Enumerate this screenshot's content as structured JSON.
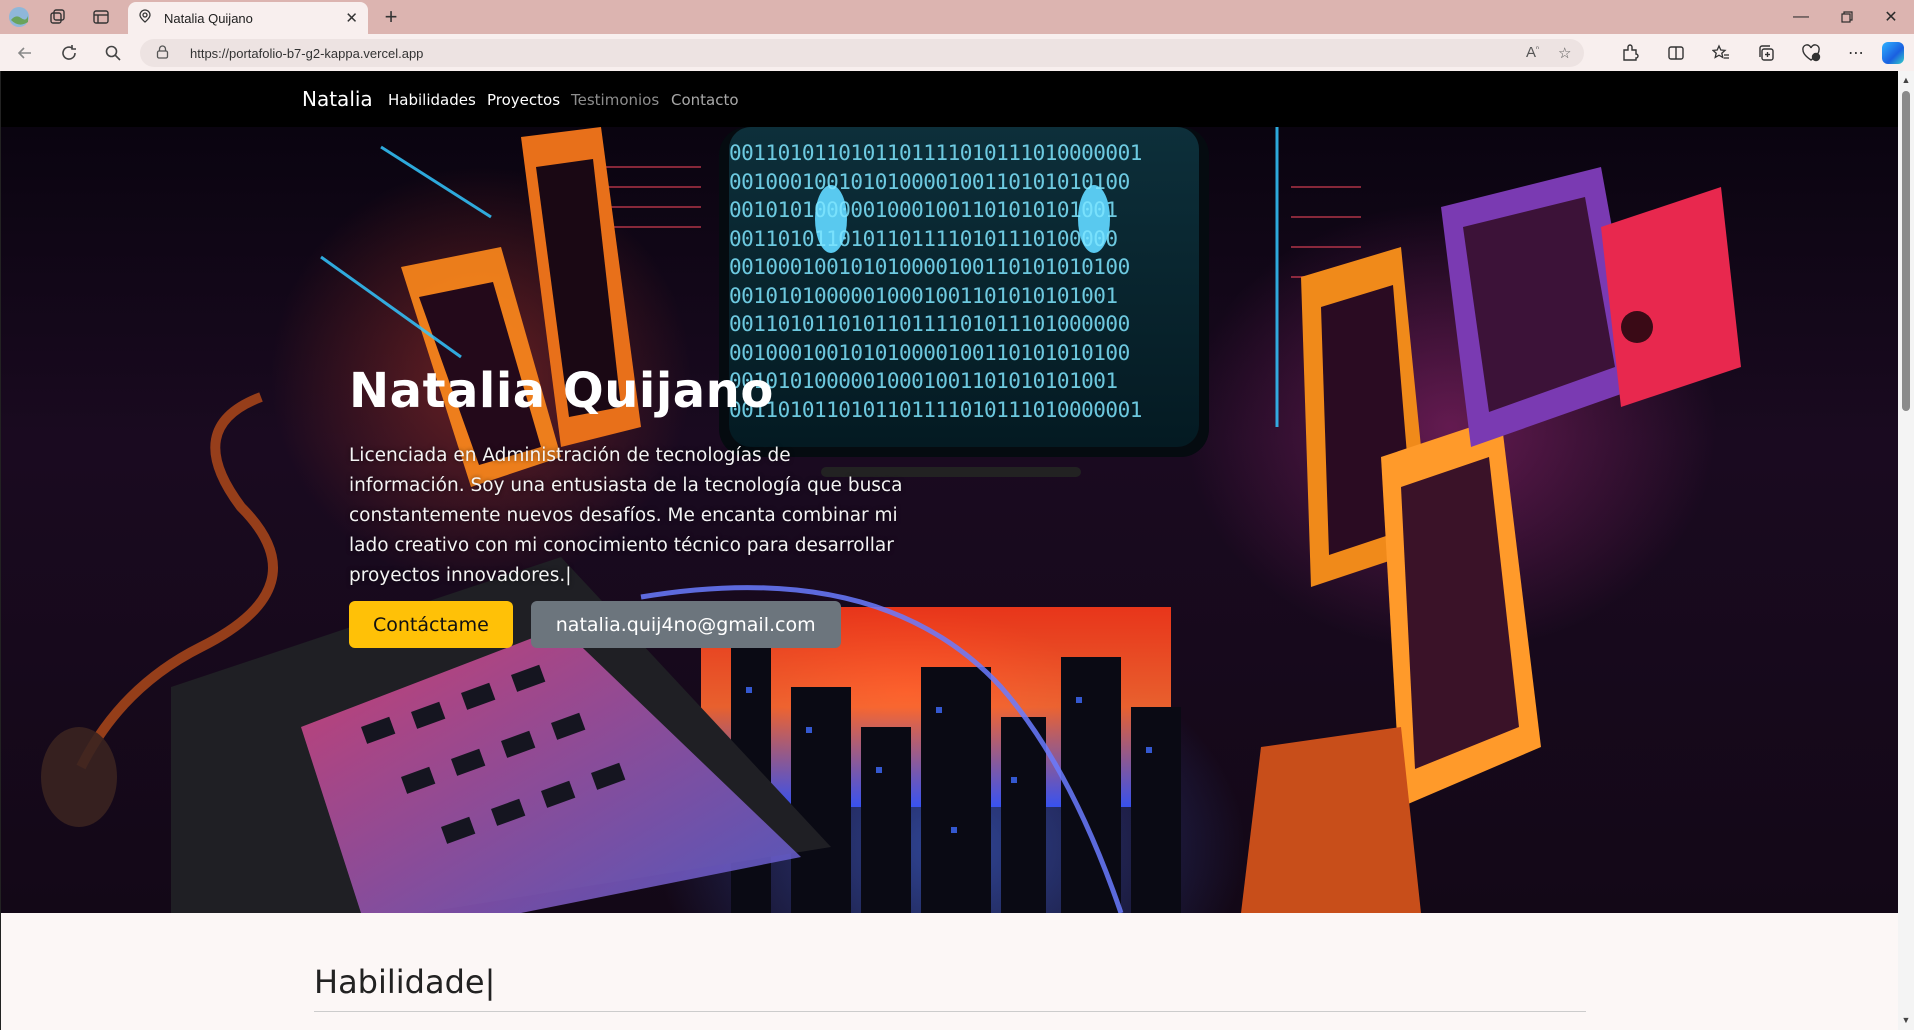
{
  "browser": {
    "tab_title": "Natalia Quijano",
    "url": "https://portafolio-b7-g2-kappa.vercel.app",
    "new_tab_icon": "+",
    "icons": [
      "profile-icon",
      "workspaces-icon",
      "tab-actions-icon",
      "globe-icon",
      "close-icon",
      "minimize-icon",
      "restore-icon",
      "window-close-icon",
      "back-icon",
      "refresh-icon",
      "search-icon",
      "lock-icon",
      "read-aloud-icon",
      "favorite-star-icon",
      "extensions-icon",
      "split-screen-icon",
      "favorites-icon",
      "collections-icon",
      "browser-essentials-icon",
      "more-icon",
      "copilot-icon"
    ]
  },
  "nav": {
    "brand": "Natalia",
    "links": [
      {
        "label": "Habilidades",
        "color": "#ffffff"
      },
      {
        "label": "Proyectos",
        "color": "#ffffff"
      },
      {
        "label": "Testimonios",
        "color": "#8d8d8d"
      },
      {
        "label": "Contacto",
        "color": "#a8a8a8"
      }
    ]
  },
  "hero": {
    "title": "Natalia Quijano",
    "description": "Licenciada en Administración de tecnologías de información. Soy una entusiasta de la tecnología que busca constantemente nuevos desafíos. Me encanta combinar mi lado creativo con mi conocimiento técnico para desarrollar proyectos innovadores.|",
    "primary_button": "Contáctame",
    "secondary_button": "natalia.quij4no@gmail.com",
    "binary_rows": [
      "0011010110101101111010111010000001",
      "001000100101010000100110101010100",
      "00101010000010001001101010101001",
      "00110101101011011110101110100000",
      "001000100101010000100110101010100",
      "00101010000010001001101010101001",
      "001101011010110111101011101000000",
      "001000100101010000100110101010100",
      "00101010000010001001101010101001",
      "0011010110101101111010111010000001"
    ]
  },
  "skills": {
    "title": "Habilidade|"
  },
  "colors": {
    "accent_yellow": "#ffc107",
    "secondary_gray": "#6c757d",
    "browser_frame": "#dcb4b0",
    "binary_cyan": "#7fe6ff"
  }
}
